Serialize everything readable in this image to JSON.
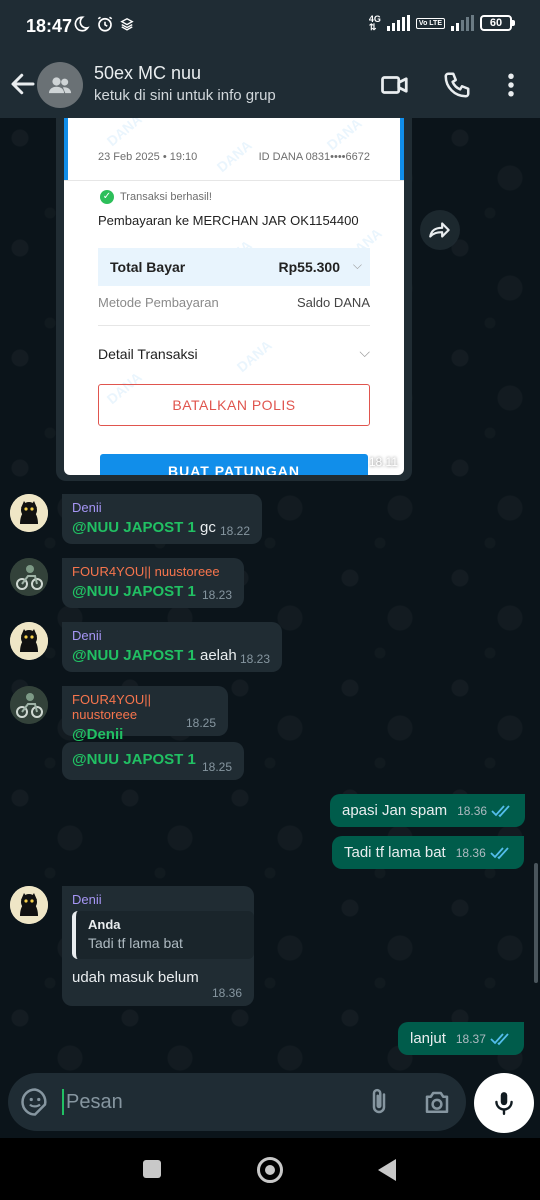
{
  "status_bar": {
    "time": "18:47",
    "network": "4G",
    "volte": "Vo LTE",
    "battery": "60"
  },
  "header": {
    "group_name": "50ex MC nuu",
    "subtitle": "ketuk di sini untuk info grup"
  },
  "receipt": {
    "date": "23 Feb 2025 • 19:10",
    "dana_id": "ID DANA 0831••••6672",
    "status": "Transaksi berhasil!",
    "payment_to": "Pembayaran ke MERCHAN JAR OK1154400",
    "total_label": "Total Bayar",
    "total_value": "Rp55.300",
    "method_label": "Metode Pembayaran",
    "method_value": "Saldo DANA",
    "detail_label": "Detail Transaksi",
    "cancel_button": "BATALKAN POLIS",
    "create_button": "BUAT PATUNGAN",
    "watermark": "DANA",
    "time": "18.11"
  },
  "messages": [
    {
      "sender": "Denii",
      "mention": "@NUU JAPOST 1",
      "text": " gc",
      "time": "18.22"
    },
    {
      "sender": "FOUR4YOU|| nuustoreee",
      "mention": "@NUU JAPOST 1",
      "text": "",
      "time": "18.23"
    },
    {
      "sender": "Denii",
      "mention": "@NUU JAPOST 1",
      "text": " aelah",
      "time": "18.23"
    },
    {
      "sender": "FOUR4YOU|| nuustoreee",
      "mention": "@Denii",
      "text": "",
      "time": "18.25"
    },
    {
      "sender": "",
      "mention": "@NUU JAPOST 1",
      "text": "",
      "time": "18.25"
    },
    {
      "sender": "Denii",
      "quote_name": "Anda",
      "quote_text": "Tadi tf lama bat",
      "text": "udah masuk belum",
      "time": "18.36"
    }
  ],
  "outgoing": [
    {
      "text": "apasi Jan spam",
      "time": "18.36"
    },
    {
      "text": "Tadi tf lama bat",
      "time": "18.36"
    },
    {
      "text": "lanjut",
      "time": "18.37"
    }
  ],
  "input": {
    "placeholder": "Pesan"
  },
  "colors": {
    "outgoing_bubble": "#005c4b",
    "incoming_bubble": "#202c33",
    "mention": "#21c063",
    "denii_name": "#a696f5",
    "four_name": "#f7754d",
    "read_ticks": "#53bdeb"
  }
}
